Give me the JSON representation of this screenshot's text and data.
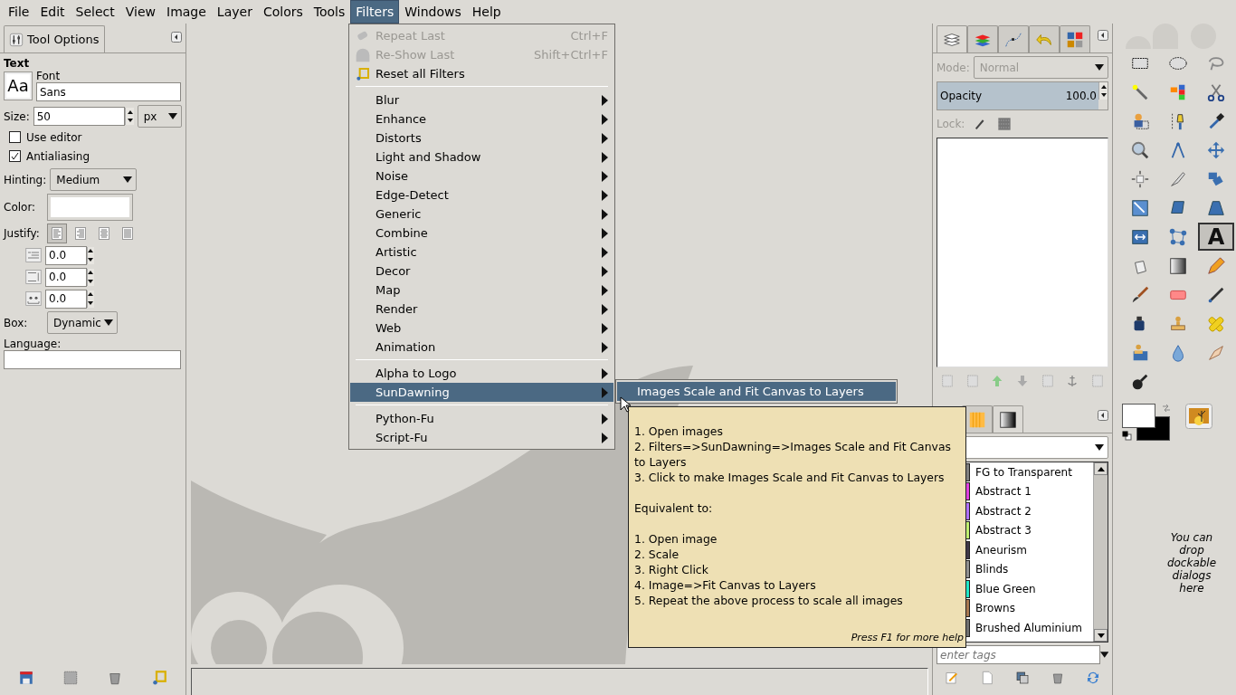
{
  "menubar": [
    {
      "label": "File",
      "selected": false
    },
    {
      "label": "Edit",
      "selected": false
    },
    {
      "label": "Select",
      "selected": false
    },
    {
      "label": "View",
      "selected": false
    },
    {
      "label": "Image",
      "selected": false
    },
    {
      "label": "Layer",
      "selected": false
    },
    {
      "label": "Colors",
      "selected": false
    },
    {
      "label": "Tools",
      "selected": false
    },
    {
      "label": "Filters",
      "selected": true
    },
    {
      "label": "Windows",
      "selected": false
    },
    {
      "label": "Help",
      "selected": false
    }
  ],
  "filters_menu": {
    "items": [
      {
        "kind": "repeat",
        "label": "Repeat Last",
        "shortcut": "Ctrl+F",
        "disabled": true
      },
      {
        "kind": "reshow",
        "label": "Re-Show Last",
        "shortcut": "Shift+Ctrl+F",
        "disabled": true
      },
      {
        "kind": "reset",
        "label": "Reset all Filters",
        "disabled": false
      },
      {
        "kind": "separator"
      },
      {
        "kind": "submenu",
        "label": "Blur",
        "selected": false
      },
      {
        "kind": "submenu",
        "label": "Enhance",
        "selected": false
      },
      {
        "kind": "submenu",
        "label": "Distorts",
        "selected": false
      },
      {
        "kind": "submenu",
        "label": "Light and Shadow",
        "selected": false
      },
      {
        "kind": "submenu",
        "label": "Noise",
        "selected": false
      },
      {
        "kind": "submenu",
        "label": "Edge-Detect",
        "selected": false
      },
      {
        "kind": "submenu",
        "label": "Generic",
        "selected": false
      },
      {
        "kind": "submenu",
        "label": "Combine",
        "selected": false
      },
      {
        "kind": "submenu",
        "label": "Artistic",
        "selected": false
      },
      {
        "kind": "submenu",
        "label": "Decor",
        "selected": false
      },
      {
        "kind": "submenu",
        "label": "Map",
        "selected": false
      },
      {
        "kind": "submenu",
        "label": "Render",
        "selected": false
      },
      {
        "kind": "submenu",
        "label": "Web",
        "selected": false
      },
      {
        "kind": "submenu",
        "label": "Animation",
        "selected": false
      },
      {
        "kind": "separator"
      },
      {
        "kind": "submenu",
        "label": "Alpha to Logo",
        "selected": false
      },
      {
        "kind": "submenu",
        "label": "SunDawning",
        "selected": true
      },
      {
        "kind": "separator"
      },
      {
        "kind": "submenu",
        "label": "Python-Fu",
        "selected": false
      },
      {
        "kind": "submenu",
        "label": "Script-Fu",
        "selected": false
      }
    ]
  },
  "submenu": {
    "items": [
      {
        "label": "Images Scale and Fit Canvas to Layers",
        "selected": true
      }
    ]
  },
  "tooltip": {
    "sections": [
      {
        "lines": [
          "1. Open images",
          "2. Filters=>SunDawning=>Images Scale and Fit Canvas to Layers",
          "3. Click to make Images Scale and Fit Canvas to Layers"
        ]
      },
      {
        "lines": [
          "Equivalent to:"
        ]
      },
      {
        "lines": [
          "1. Open image",
          "2. Scale",
          "3. Right Click",
          "4. Image=>Fit Canvas to Layers",
          "5. Repeat the above process to scale all images"
        ]
      }
    ],
    "footer": "Press F1 for more help"
  },
  "tool_options": {
    "tab": "Tool Options",
    "title": "Text",
    "font_preview": "Aa",
    "font_label": "Font",
    "font": "Sans",
    "size_label": "Size:",
    "size": "50",
    "unit": "px",
    "checkboxes": [
      {
        "label": "Use editor",
        "checked": false
      },
      {
        "label": "Antialiasing",
        "checked": true
      }
    ],
    "hinting_label": "Hinting:",
    "hinting": "Medium",
    "color_label": "Color:",
    "justify_label": "Justify:",
    "justify": [
      {
        "selected": true
      },
      {
        "selected": false
      },
      {
        "selected": false
      },
      {
        "selected": false
      }
    ],
    "spins": [
      {
        "kind": "indent",
        "value": "0.0"
      },
      {
        "kind": "line-spacing",
        "value": "0.0"
      },
      {
        "kind": "letter-spacing",
        "value": "0.0"
      }
    ],
    "box_label": "Box:",
    "box": "Dynamic",
    "language_label": "Language:"
  },
  "layers_dock": {
    "tabs": [
      {
        "kind": "layers",
        "selected": true
      },
      {
        "kind": "channels",
        "selected": false
      },
      {
        "kind": "paths",
        "selected": false
      },
      {
        "kind": "undo",
        "selected": false
      },
      {
        "kind": "colormap",
        "selected": false
      }
    ],
    "mode_label": "Mode:",
    "mode": "Normal",
    "opacity": {
      "label": "Opacity",
      "value": "100.0",
      "level": 1
    },
    "lock_label": "Lock:"
  },
  "gradients_dock": {
    "tabs": [
      {
        "kind": "patterns",
        "selected": false
      },
      {
        "kind": "gradients",
        "selected": true
      }
    ],
    "items": [
      {
        "name": "FG to Transparent",
        "color": "#808080"
      },
      {
        "name": "Abstract 1",
        "color": "#e040e0"
      },
      {
        "name": "Abstract 2",
        "color": "#b070ff"
      },
      {
        "name": "Abstract 3",
        "color": "#c0f070"
      },
      {
        "name": "Aneurism",
        "color": "#403848"
      },
      {
        "name": "Blinds",
        "color": "#909090"
      },
      {
        "name": "Blue Green",
        "color": "#20e8c8"
      },
      {
        "name": "Browns",
        "color": "#a87850"
      },
      {
        "name": "Brushed Aluminium",
        "color": "#707070"
      }
    ],
    "tags_placeholder": "enter tags"
  },
  "toolbox": {
    "tools": [
      {
        "kind": "rect",
        "selected": false
      },
      {
        "kind": "ellipse",
        "selected": false
      },
      {
        "kind": "lasso",
        "selected": false
      },
      {
        "kind": "wand",
        "selected": false
      },
      {
        "kind": "colorsel",
        "selected": false
      },
      {
        "kind": "scissors",
        "selected": false
      },
      {
        "kind": "fgselect",
        "selected": false
      },
      {
        "kind": "paths",
        "selected": false
      },
      {
        "kind": "picker",
        "selected": false
      },
      {
        "kind": "zoom",
        "selected": false
      },
      {
        "kind": "measure",
        "selected": false
      },
      {
        "kind": "move",
        "selected": false
      },
      {
        "kind": "align",
        "selected": false
      },
      {
        "kind": "crop",
        "selected": false
      },
      {
        "kind": "rotate",
        "selected": false
      },
      {
        "kind": "scale",
        "selected": false
      },
      {
        "kind": "shear",
        "selected": false
      },
      {
        "kind": "perspective",
        "selected": false
      },
      {
        "kind": "flip",
        "selected": false
      },
      {
        "kind": "cage",
        "selected": false
      },
      {
        "kind": "text",
        "glyph": "A",
        "selected": true
      },
      {
        "kind": "bucket",
        "selected": false
      },
      {
        "kind": "blend",
        "selected": false
      },
      {
        "kind": "pencil",
        "selected": false
      },
      {
        "kind": "brush",
        "selected": false
      },
      {
        "kind": "eraser",
        "selected": false
      },
      {
        "kind": "airbrush",
        "selected": false
      },
      {
        "kind": "ink",
        "selected": false
      },
      {
        "kind": "clone",
        "selected": false
      },
      {
        "kind": "heal",
        "selected": false
      },
      {
        "kind": "pclone",
        "selected": false
      },
      {
        "kind": "blur",
        "selected": false
      },
      {
        "kind": "smudge",
        "selected": false
      },
      {
        "kind": "dodge",
        "selected": false
      }
    ]
  },
  "drop_hint": "You can drop dockable dialogs here"
}
